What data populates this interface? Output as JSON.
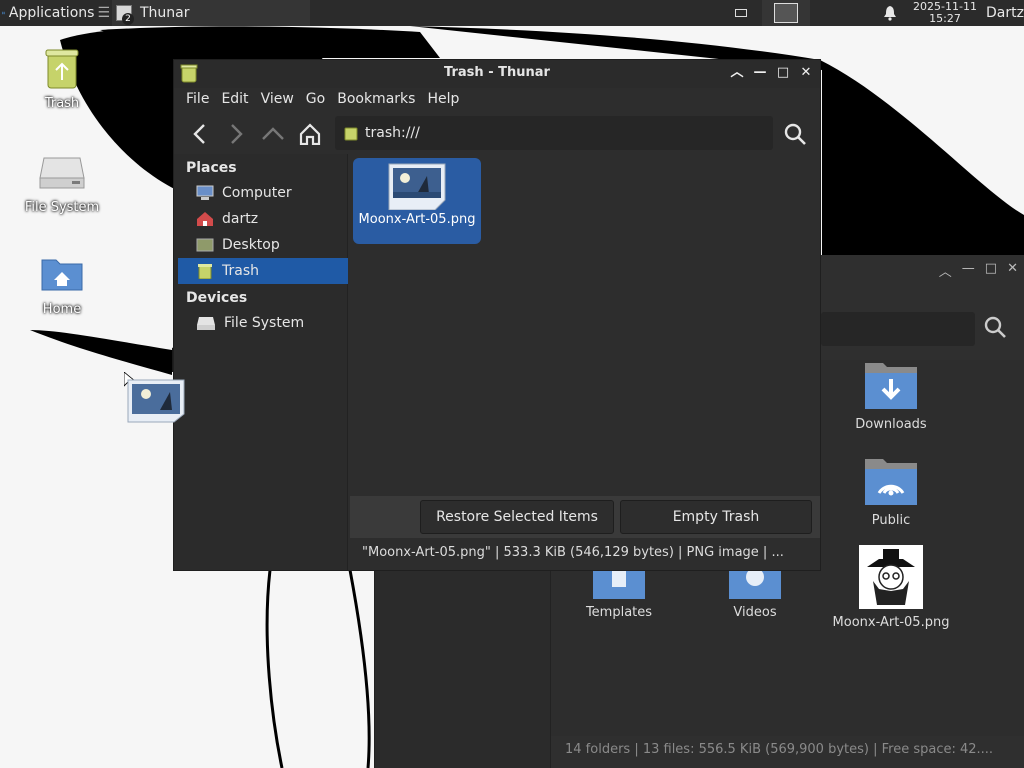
{
  "panel": {
    "applications_label": "Applications",
    "task_label": "Thunar",
    "task_count": "2",
    "clock_date": "2025-11-11",
    "clock_time": "15:27",
    "user_label": "Dartz"
  },
  "desktop": {
    "icons": [
      {
        "label": "Trash",
        "icon": "trash-icon"
      },
      {
        "label": "File System",
        "icon": "drive-icon"
      },
      {
        "label": "Home",
        "icon": "home-folder-icon"
      }
    ]
  },
  "trash_window": {
    "title": "Trash - Thunar",
    "menu": [
      "File",
      "Edit",
      "View",
      "Go",
      "Bookmarks",
      "Help"
    ],
    "location": "trash:///",
    "sidebar": {
      "places_header": "Places",
      "places": [
        "Computer",
        "dartz",
        "Desktop",
        "Trash"
      ],
      "devices_header": "Devices",
      "devices": [
        "File System"
      ]
    },
    "files": [
      {
        "name": "Moonx-Art-05.png",
        "icon": "image-file-icon"
      }
    ],
    "buttons": {
      "restore": "Restore Selected Items",
      "empty": "Empty Trash"
    },
    "status": "\"Moonx-Art-05.png\"  |  533.3 KiB (546,129 bytes)  |  PNG image  | ..."
  },
  "home_window": {
    "items": [
      {
        "label": "Downloads",
        "icon": "downloads-folder-icon"
      },
      {
        "label": "Public",
        "icon": "public-folder-icon"
      },
      {
        "label": "Templates",
        "icon": "templates-folder-icon"
      },
      {
        "label": "Videos",
        "icon": "videos-folder-icon"
      },
      {
        "label": "Moonx-Art-05.png",
        "icon": "image-thumbnail-icon"
      }
    ],
    "status": "14 folders  |  13 files: 556.5 KiB (569,900 bytes)  |  Free space: 42...."
  },
  "colors": {
    "selection": "#1f5aa6",
    "panel": "#2b2b2b",
    "window": "#2d2d2d"
  }
}
